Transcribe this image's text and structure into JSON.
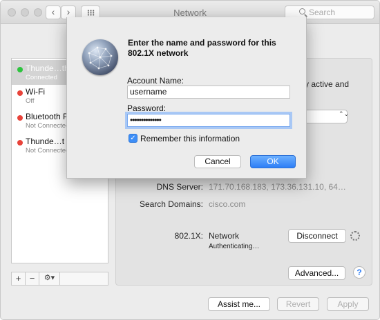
{
  "window": {
    "title": "Network",
    "search_placeholder": "Search",
    "back_glyph": "‹",
    "forward_glyph": "›"
  },
  "sidebar": {
    "services": [
      {
        "name": "Thunde…thet",
        "status": "Connected",
        "color": "#2dc43e",
        "selected": true
      },
      {
        "name": "Wi-Fi",
        "status": "Off",
        "color": "#e8433a",
        "selected": false
      },
      {
        "name": "Bluetooth PAN",
        "status": "Not Connected",
        "color": "#e8433a",
        "selected": false
      },
      {
        "name": "Thunde…t Bridge",
        "status": "Not Connected",
        "color": "#e8433a",
        "selected": false
      }
    ],
    "footer": {
      "add": "+",
      "remove": "−",
      "gear": "⚙▾"
    }
  },
  "main": {
    "partial_text": "y active and",
    "dns_label": "DNS Server:",
    "dns_value": "171.70.168.183, 173.36.131.10, 64…",
    "search_domains_label": "Search Domains:",
    "search_domains_value": "cisco.com",
    "dot1x_label": "802.1X:",
    "dot1x_value": "Network",
    "dot1x_status": "Authenticating…",
    "disconnect": "Disconnect",
    "advanced": "Advanced...",
    "help": "?",
    "popup_arrows": "⌃⌄"
  },
  "footer": {
    "assist": "Assist me...",
    "revert": "Revert",
    "apply": "Apply"
  },
  "sheet": {
    "title": "Enter the name and password for this 802.1X network",
    "account_label": "Account Name:",
    "account_value": "username",
    "password_label": "Password:",
    "password_value": "••••••••••••••",
    "remember_label": "Remember this information",
    "remember_checked": true,
    "cancel": "Cancel",
    "ok": "OK"
  }
}
